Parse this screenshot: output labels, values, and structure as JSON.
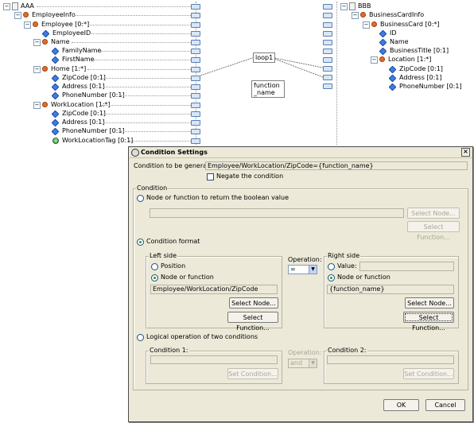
{
  "left_tree": {
    "nodes": [
      {
        "label": "AAA",
        "icon": "document-icon"
      },
      {
        "label": "EmployeeInfo",
        "icon": "element-icon"
      },
      {
        "label": "Employee [0:*]",
        "icon": "element-icon"
      },
      {
        "label": "EmployeeID",
        "icon": "attribute-icon"
      },
      {
        "label": "Name",
        "icon": "element-icon"
      },
      {
        "label": "FamilyName",
        "icon": "attribute-icon"
      },
      {
        "label": "FirstName",
        "icon": "attribute-icon"
      },
      {
        "label": "Home [1:*]",
        "icon": "element-icon"
      },
      {
        "label": "ZipCode [0:1]",
        "icon": "attribute-icon"
      },
      {
        "label": "Address [0:1]",
        "icon": "attribute-icon"
      },
      {
        "label": "PhoneNumber [0:1]",
        "icon": "attribute-icon"
      },
      {
        "label": "WorkLocation [1:*]",
        "icon": "element-icon"
      },
      {
        "label": "ZipCode [0:1]",
        "icon": "attribute-icon"
      },
      {
        "label": "Address [0:1]",
        "icon": "attribute-icon"
      },
      {
        "label": "PhoneNumber [0:1]",
        "icon": "attribute-icon"
      },
      {
        "label": "WorkLocationTag [0:1]",
        "icon": "tag-icon"
      }
    ]
  },
  "right_tree": {
    "nodes": [
      {
        "label": "BBB",
        "icon": "document-icon"
      },
      {
        "label": "BusinessCardInfo",
        "icon": "element-icon"
      },
      {
        "label": "BusinessCard [0:*]",
        "icon": "element-icon"
      },
      {
        "label": "ID",
        "icon": "attribute-icon"
      },
      {
        "label": "Name",
        "icon": "attribute-icon"
      },
      {
        "label": "BusinessTitle [0:1]",
        "icon": "attribute-icon"
      },
      {
        "label": "Location [1:*]",
        "icon": "element-icon"
      },
      {
        "label": "ZipCode [0:1]",
        "icon": "attribute-icon"
      },
      {
        "label": "Address [0:1]",
        "icon": "attribute-icon"
      },
      {
        "label": "PhoneNumber [0:1]",
        "icon": "attribute-icon"
      }
    ]
  },
  "canvas": {
    "loop_label": "loop1",
    "function_label": "function_name"
  },
  "dialog": {
    "title": "Condition Settings",
    "close_glyph": "×",
    "condition_to_generate_label": "Condition to be generated:",
    "condition_to_generate_value": "Employee/WorkLocation/ZipCode={function_name}",
    "negate_label": "Negate the condition",
    "condition_group": "Condition",
    "opt_boolean_label": "Node or function to return the boolean value",
    "select_node_label": "Select Node...",
    "select_function_label": "Select Function...",
    "opt_format_label": "Condition format",
    "left_side": {
      "title": "Left side",
      "position_label": "Position",
      "node_or_function_label": "Node or function",
      "value": "Employee/WorkLocation/ZipCode",
      "select_node": "Select Node...",
      "select_function": "Select Function..."
    },
    "operation": {
      "label": "Operation:",
      "value": "="
    },
    "right_side": {
      "title": "Right side",
      "value_label": "Value:",
      "node_or_function_label": "Node or function",
      "value": "{function_name}",
      "select_node": "Select Node...",
      "select_function": "Select Function..."
    },
    "opt_logical_label": "Logical operation of two conditions",
    "condition1": {
      "title": "Condition 1:",
      "button": "Set Condition..."
    },
    "logical_operation": {
      "label": "Operation:",
      "value": "and"
    },
    "condition2": {
      "title": "Condition 2:",
      "button": "Set Condition..."
    },
    "ok_label": "OK",
    "cancel_label": "Cancel"
  }
}
